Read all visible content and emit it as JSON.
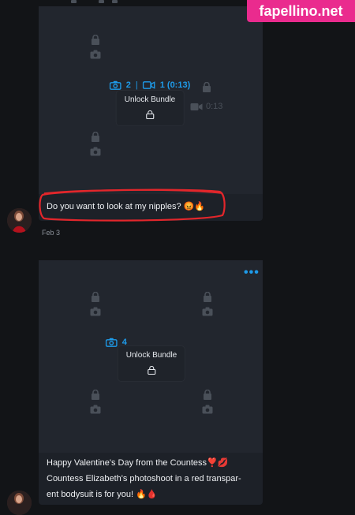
{
  "watermark": "fapellino.net",
  "post1": {
    "photo_count": "2",
    "separator": "|",
    "video_count": "1 (0:13)",
    "unlock_label": "Unlock Bundle",
    "video_duration": "0:13",
    "caption": "Do you want to look at my nipples? 😡🔥",
    "date": "Feb 3"
  },
  "post2": {
    "photo_count": "4",
    "unlock_label": "Unlock Bundle",
    "more_label": "•••",
    "caption_line1": "Happy Valentine's Day from the Countess❣️💋",
    "caption_line2": "Countess Elizabeth's photoshoot in a red transpar-",
    "caption_line3": "ent bodysuit is for you! 🔥🩸"
  },
  "colors": {
    "accent": "#1e9bea",
    "highlight": "#e3262b",
    "brand": "#ea2b8e"
  }
}
